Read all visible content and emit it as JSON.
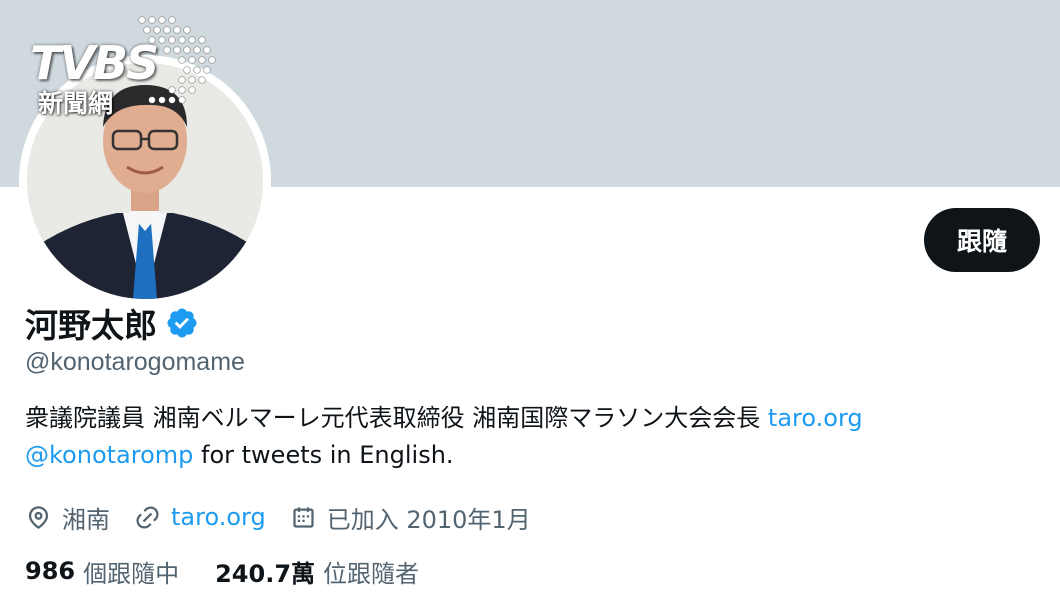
{
  "profile": {
    "display_name": "河野太郎",
    "handle": "@konotarogomame",
    "follow_label": "跟隨",
    "verified": true
  },
  "bio": {
    "text": "衆議院議員 湘南ベルマーレ元代表取締役 湘南国際マラソン大会会長",
    "link": "taro.org",
    "mention": "@konotaromp",
    "suffix": "for tweets in English."
  },
  "meta": {
    "location": "湘南",
    "website": "taro.org",
    "joined": "已加入 2010年1月"
  },
  "stats": {
    "following_count": "986",
    "following_label": "個跟隨中",
    "followers_count": "240.7萬",
    "followers_label": "位跟隨者"
  },
  "watermark": {
    "wordmark": "TVBS",
    "subtitle": "新聞網"
  },
  "icons": {
    "verified": "verified-badge-icon",
    "location": "location-pin-icon",
    "link": "link-icon",
    "calendar": "calendar-icon"
  },
  "colors": {
    "banner": "#cfd9de",
    "link": "#1d9bf0",
    "secondary_text": "#536471",
    "primary_text": "#0f1419",
    "follow_button": "#0f1419"
  }
}
